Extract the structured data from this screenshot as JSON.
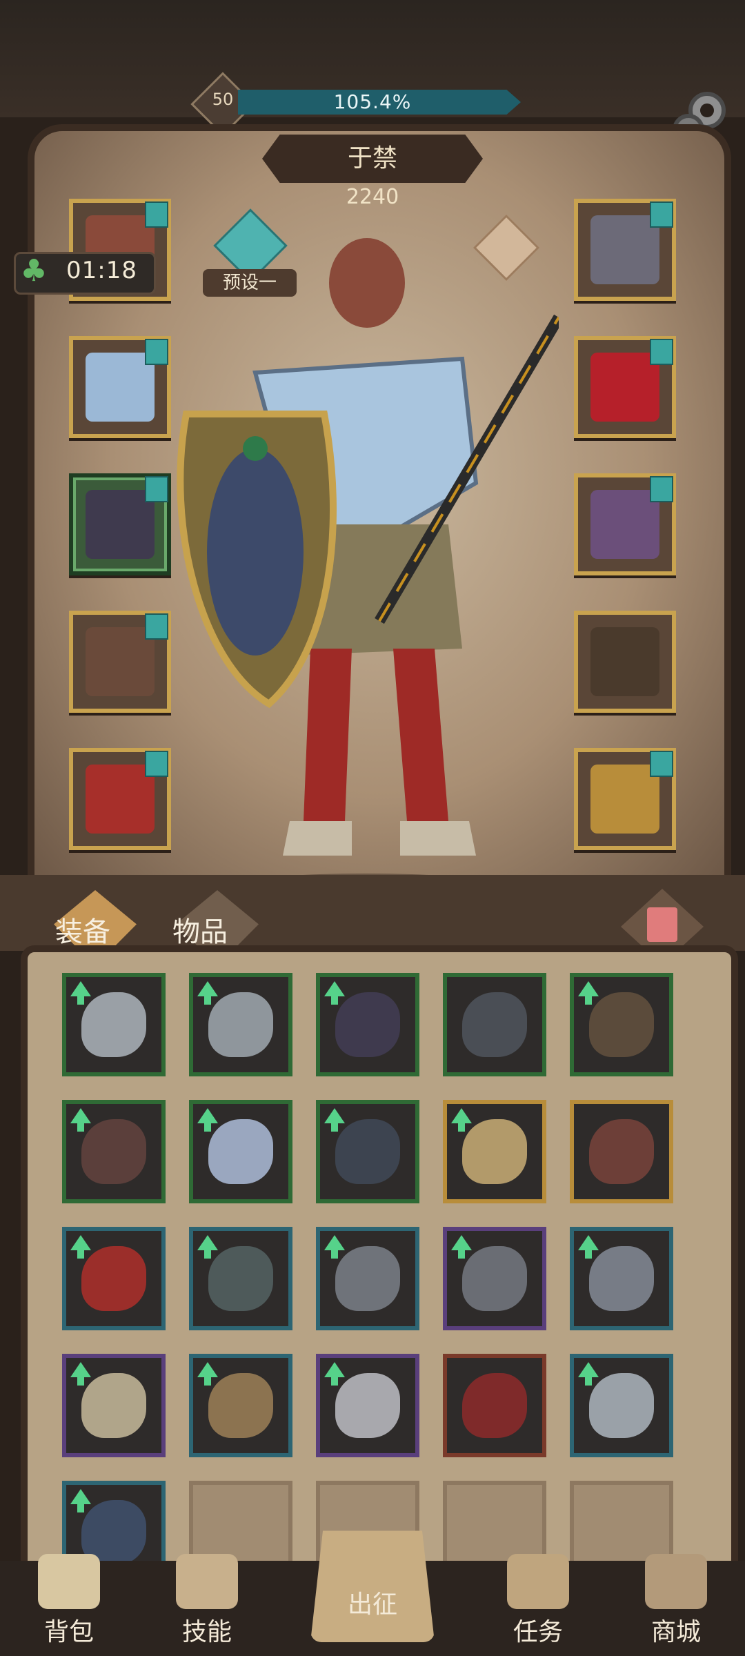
{
  "header": {
    "level": "50",
    "xp_percent_text": "105.4%",
    "xp_fraction": 1.0,
    "gear_icon": "settings-gear-icon"
  },
  "character": {
    "name": "于禁",
    "power": "2240",
    "preset_label": "预设一",
    "timer": "01:18"
  },
  "equipment_slots": {
    "left": [
      {
        "name": "helmet-slot",
        "variant": "gold",
        "badge": true,
        "icon": "leather-mask-icon"
      },
      {
        "name": "chest-slot",
        "variant": "gold",
        "badge": true,
        "icon": "ice-armor-icon"
      },
      {
        "name": "gloves-slot",
        "variant": "green",
        "badge": true,
        "icon": "dark-gauntlet-icon"
      },
      {
        "name": "pants-slot",
        "variant": "gold",
        "badge": true,
        "icon": "leather-skirt-icon"
      },
      {
        "name": "boots-slot",
        "variant": "gold",
        "badge": true,
        "icon": "red-boots-icon"
      }
    ],
    "right": [
      {
        "name": "necklace-slot",
        "variant": "gold",
        "badge": true,
        "icon": "chain-skull-icon"
      },
      {
        "name": "ring-slot",
        "variant": "gold",
        "badge": true,
        "icon": "red-helmet-icon"
      },
      {
        "name": "weapon-slot",
        "variant": "gold",
        "badge": true,
        "icon": "demon-claw-icon"
      },
      {
        "name": "offhand-slot",
        "variant": "gold",
        "badge": false,
        "icon": "lightning-spear-icon"
      },
      {
        "name": "shield-slot",
        "variant": "gold",
        "badge": true,
        "icon": "golden-shield-icon"
      }
    ]
  },
  "tabs": {
    "equipment": "装备",
    "items": "物品"
  },
  "inventory": [
    {
      "frame": "#2f6a35",
      "art": "#9aa0a6",
      "upgrade": true,
      "icon": "ring-icon"
    },
    {
      "frame": "#2f6a35",
      "art": "#8f969c",
      "upgrade": true,
      "icon": "ring-icon"
    },
    {
      "frame": "#2f6a35",
      "art": "#3f3a4e",
      "upgrade": true,
      "icon": "gauntlet-icon"
    },
    {
      "frame": "#2f6a35",
      "art": "#4a4e55",
      "upgrade": false,
      "icon": "hood-icon"
    },
    {
      "frame": "#2f6a35",
      "art": "#5b4b3b",
      "upgrade": true,
      "icon": "boots-icon"
    },
    {
      "frame": "#2f6a35",
      "art": "#5b3f3b",
      "upgrade": true,
      "icon": "pants-icon"
    },
    {
      "frame": "#2f6a35",
      "art": "#9aa7bf",
      "upgrade": true,
      "icon": "armor-icon"
    },
    {
      "frame": "#2f6a35",
      "art": "#3d4450",
      "upgrade": true,
      "icon": "bracer-icon"
    },
    {
      "frame": "#b88d3a",
      "art": "#b29a6a",
      "upgrade": true,
      "icon": "fist-icon"
    },
    {
      "frame": "#b88d3a",
      "art": "#6d3f38",
      "upgrade": false,
      "icon": "blade-icon"
    },
    {
      "frame": "#2d6573",
      "art": "#9b2e2a",
      "upgrade": true,
      "icon": "amulet-icon"
    },
    {
      "frame": "#2d6573",
      "art": "#4e5a5a",
      "upgrade": true,
      "icon": "boots-icon"
    },
    {
      "frame": "#2d6573",
      "art": "#6f737a",
      "upgrade": true,
      "icon": "sword-icon"
    },
    {
      "frame": "#5a3f7c",
      "art": "#6a6d74",
      "upgrade": true,
      "icon": "greaves-icon"
    },
    {
      "frame": "#2d6573",
      "art": "#777c86",
      "upgrade": true,
      "icon": "ring-icon"
    },
    {
      "frame": "#5a3f7c",
      "art": "#b0a58a",
      "upgrade": true,
      "icon": "gauntlet-icon"
    },
    {
      "frame": "#2d6573",
      "art": "#8c7350",
      "upgrade": true,
      "icon": "helmet-icon"
    },
    {
      "frame": "#5a3f7c",
      "art": "#a8a8ad",
      "upgrade": true,
      "icon": "chest-armor-icon"
    },
    {
      "frame": "#7a3a2a",
      "art": "#7f2a2a",
      "upgrade": false,
      "icon": "boots-icon"
    },
    {
      "frame": "#2d6573",
      "art": "#9aa1a8",
      "upgrade": true,
      "icon": "pendant-icon"
    },
    {
      "frame": "#2d6573",
      "art": "#3d4b63",
      "upgrade": true,
      "icon": "boots-icon"
    },
    {
      "empty": true
    },
    {
      "empty": true
    },
    {
      "empty": true
    },
    {
      "empty": true
    }
  ],
  "bottom_nav": [
    {
      "label": "背包",
      "icon": "backpack-icon"
    },
    {
      "label": "技能",
      "icon": "skill-book-icon"
    },
    {
      "label": "出征",
      "icon": "battle-map-icon"
    },
    {
      "label": "任务",
      "icon": "quest-scroll-icon"
    },
    {
      "label": "商城",
      "icon": "shop-crown-icon"
    }
  ]
}
